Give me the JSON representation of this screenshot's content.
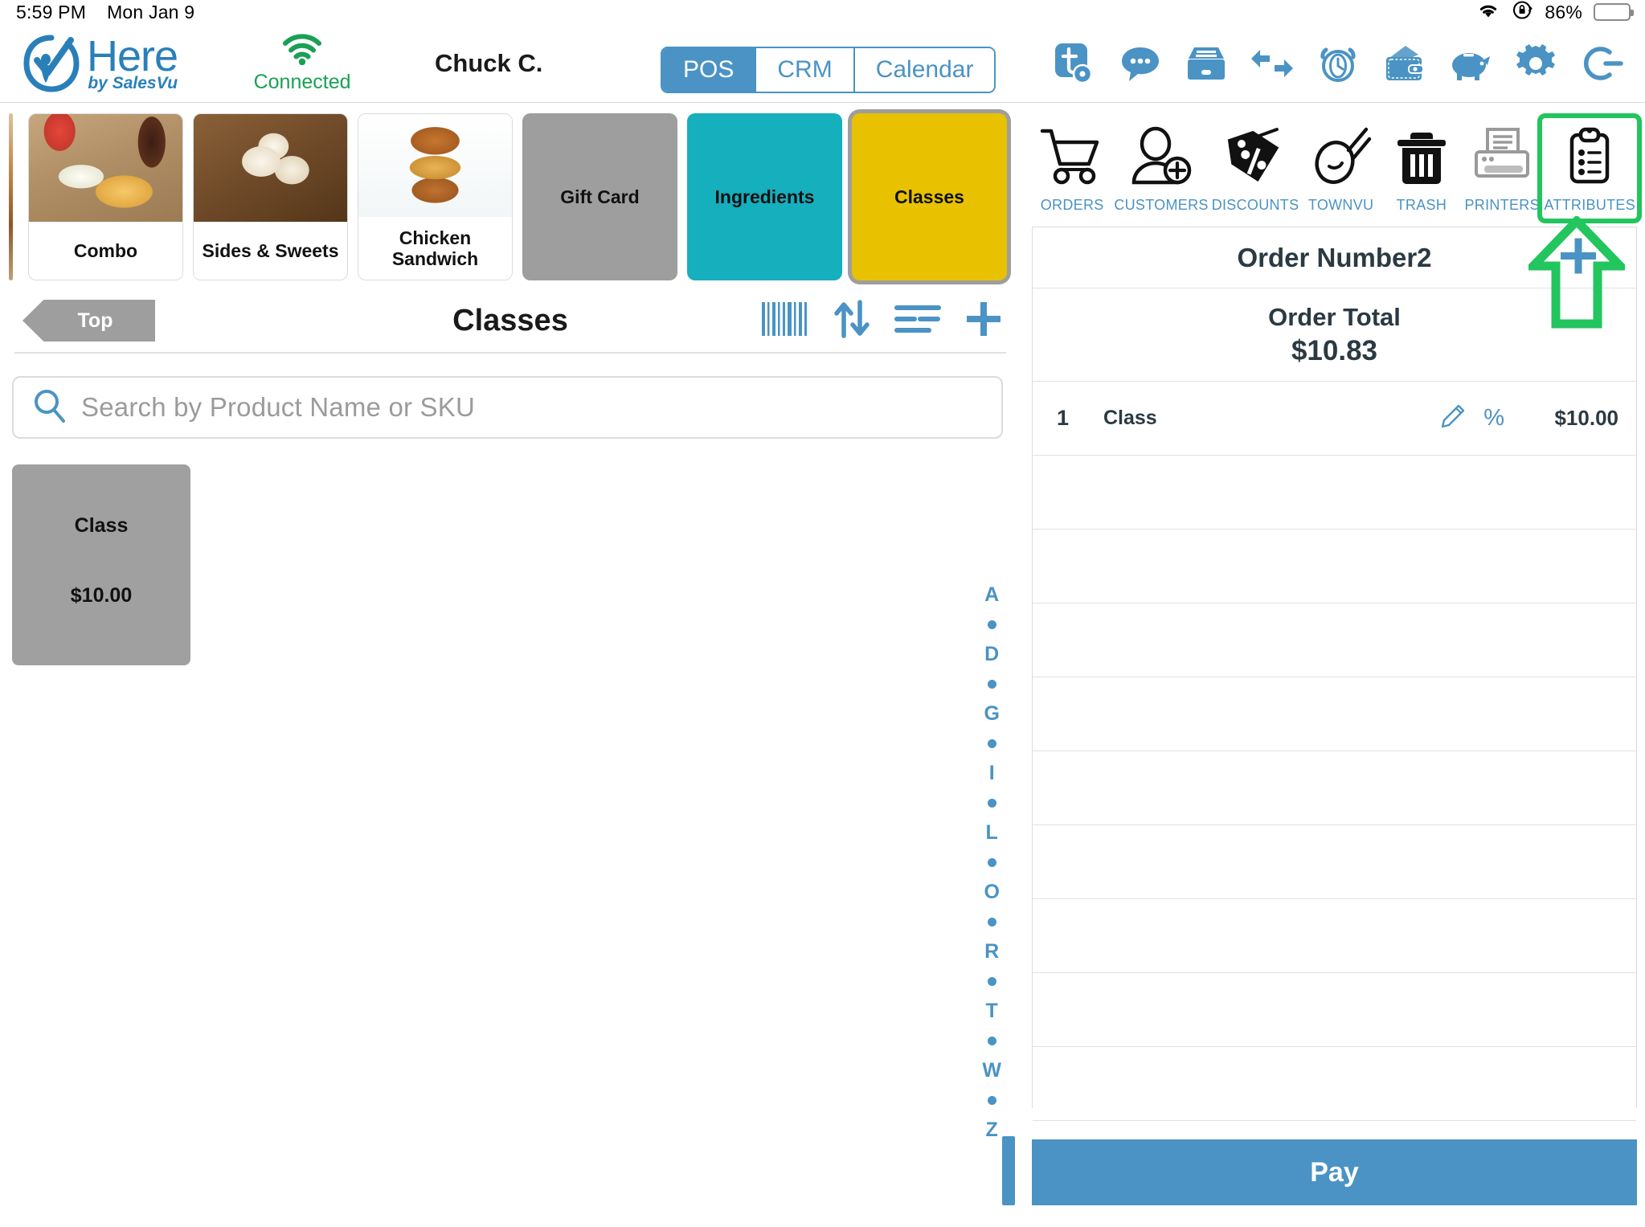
{
  "statusbar": {
    "time": "5:59 PM",
    "date": "Mon Jan 9",
    "battery_pct": "86%",
    "wifi_icon": "wifi-icon",
    "lock_rotation_icon": "rotation-lock-icon",
    "battery_icon": "battery-icon"
  },
  "header": {
    "brand_name": "Here",
    "brand_tagline": "by SalesVu",
    "connection_status": "Connected",
    "user_name": "Chuck C.",
    "tabs": [
      {
        "label": "POS",
        "active": true
      },
      {
        "label": "CRM",
        "active": false
      },
      {
        "label": "Calendar",
        "active": false
      }
    ],
    "icons": [
      {
        "name": "tip-settings-icon"
      },
      {
        "name": "messages-icon"
      },
      {
        "name": "cash-drawer-icon"
      },
      {
        "name": "transfer-icon"
      },
      {
        "name": "time-clock-icon"
      },
      {
        "name": "wallet-icon"
      },
      {
        "name": "piggy-bank-icon"
      },
      {
        "name": "settings-gear-icon"
      },
      {
        "name": "logout-icon"
      }
    ]
  },
  "categories": [
    {
      "label": "Combo",
      "type": "photo",
      "photo": "ph-combo",
      "selected": false
    },
    {
      "label": "Sides & Sweets",
      "type": "photo",
      "photo": "ph-sides",
      "selected": false
    },
    {
      "label": "Chicken Sandwich",
      "type": "photo",
      "photo": "ph-sandwich",
      "selected": false
    },
    {
      "label": "Gift Card",
      "type": "solid",
      "color": "#9e9e9e",
      "selected": false
    },
    {
      "label": "Ingredients",
      "type": "solid",
      "color": "#15afbe",
      "selected": false
    },
    {
      "label": "Classes",
      "type": "solid",
      "color": "#e8c200",
      "selected": true
    }
  ],
  "catalog": {
    "back_button": "Top",
    "title": "Classes",
    "title_icons": [
      {
        "name": "barcode-scan-icon"
      },
      {
        "name": "sort-updown-icon"
      },
      {
        "name": "list-view-icon"
      },
      {
        "name": "add-product-icon"
      }
    ],
    "search_placeholder": "Search by Product Name or SKU",
    "search_value": "",
    "products": [
      {
        "name": "Class",
        "price": "$10.00"
      }
    ],
    "alpha_index": [
      "A",
      "•",
      "D",
      "•",
      "G",
      "•",
      "I",
      "•",
      "L",
      "•",
      "O",
      "•",
      "R",
      "•",
      "T",
      "•",
      "W",
      "•",
      "Z"
    ]
  },
  "toolbar": [
    {
      "label": "ORDERS",
      "icon": "shopping-cart-icon",
      "highlight": false
    },
    {
      "label": "CUSTOMERS",
      "icon": "add-customer-icon",
      "highlight": false
    },
    {
      "label": "DISCOUNTS",
      "icon": "discount-tag-icon",
      "highlight": false
    },
    {
      "label": "TOWNVU",
      "icon": "townvu-icon",
      "highlight": false
    },
    {
      "label": "TRASH",
      "icon": "trash-icon",
      "highlight": false
    },
    {
      "label": "PRINTERS",
      "icon": "printer-icon",
      "highlight": false
    },
    {
      "label": "ATTRIBUTES",
      "icon": "clipboard-list-icon",
      "highlight": true
    }
  ],
  "order": {
    "number_label": "Order Number2",
    "total_label": "Order Total",
    "total_value": "$10.83",
    "add_item_icon": "plus-icon",
    "line_items": [
      {
        "qty": "1",
        "name": "Class",
        "edit_icon": "pencil-icon",
        "discount_icon": "percent-icon",
        "price": "$10.00"
      }
    ],
    "empty_row_count": 9,
    "pay_label": "Pay"
  },
  "annotation": {
    "arrow_icon": "green-up-arrow-annotation",
    "highlight_color": "#22c55e"
  },
  "colors": {
    "accent_blue": "#4a93c4",
    "brand_blue": "#2980b9",
    "connected_green": "#1aa053",
    "teal": "#15afbe",
    "gold": "#e8c200",
    "gray": "#9e9e9e",
    "annotation_green": "#22c55e"
  }
}
